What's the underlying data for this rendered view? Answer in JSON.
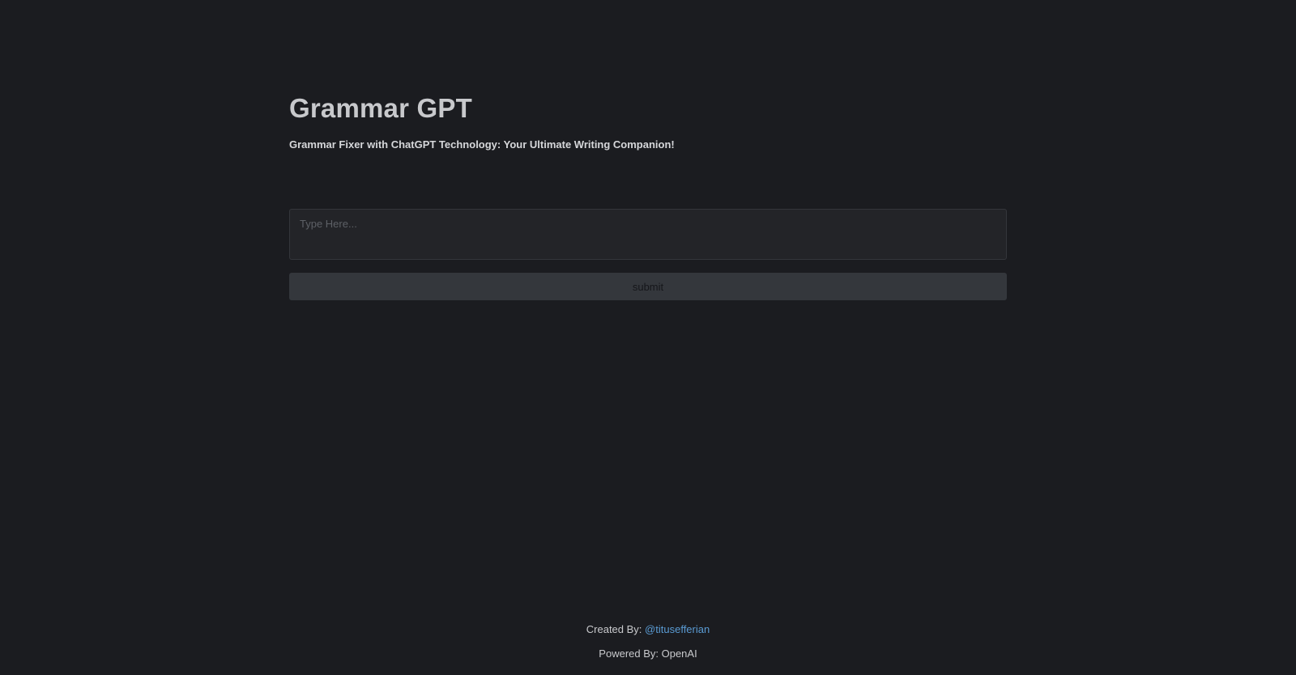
{
  "header": {
    "title": "Grammar GPT",
    "subtitle": "Grammar Fixer with ChatGPT Technology: Your Ultimate Writing Companion!"
  },
  "form": {
    "input_placeholder": "Type Here...",
    "input_value": "",
    "submit_label": "submit"
  },
  "footer": {
    "created_prefix": "Created By:",
    "created_handle": "@titusefferian",
    "powered_text": "Powered By: OpenAI"
  },
  "colors": {
    "background": "#1b1c20",
    "title": "#c8c9cc",
    "link": "#5a9bd3",
    "button": "#34373c"
  }
}
